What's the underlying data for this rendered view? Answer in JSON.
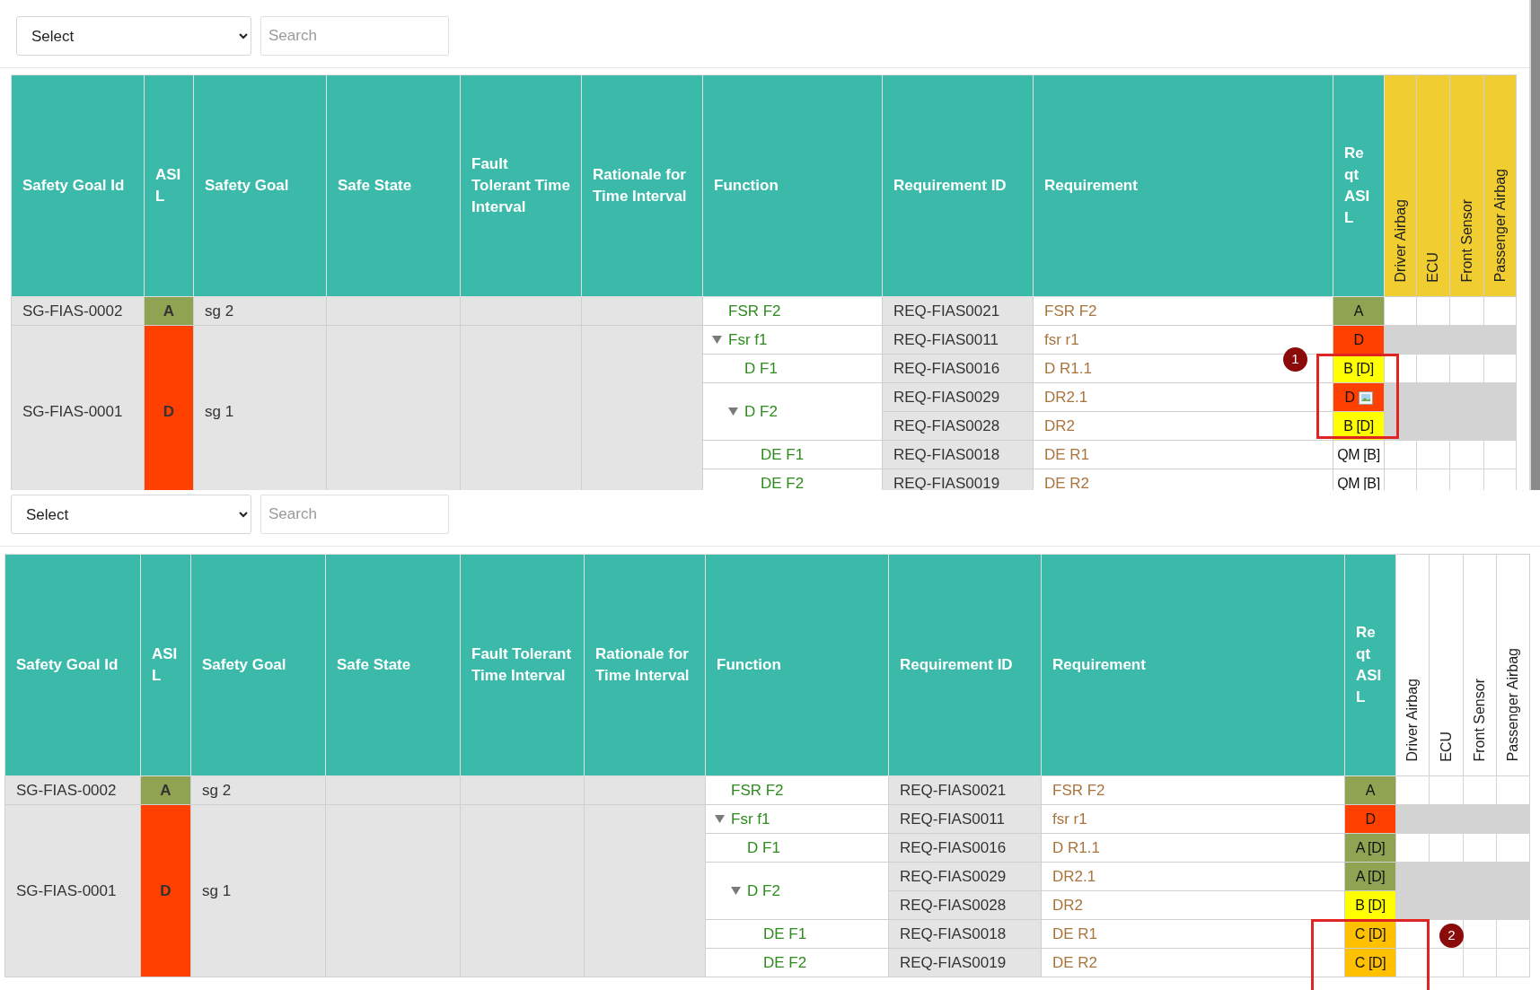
{
  "panels": [
    {
      "select": {
        "value": "Select"
      },
      "search": {
        "placeholder": "Search"
      },
      "columns": [
        "Safety Goal Id",
        "ASIL",
        "Safety Goal",
        "Safe State",
        "Fault Tolerant Time Interval",
        "Rationale for Time Interval",
        "Function",
        "Requirement ID",
        "Requirement",
        "Reqt ASIL"
      ],
      "allocation_columns": [
        {
          "label": "Driver Airbag",
          "highlighted": true
        },
        {
          "label": "ECU",
          "highlighted": true
        },
        {
          "label": "Front Sensor",
          "highlighted": true
        },
        {
          "label": "Passenger Airbag",
          "highlighted": true
        }
      ],
      "safety_goals": [
        {
          "id": "SG-FIAS-0002",
          "asil": "A",
          "color": "#8fa352",
          "goal": "sg 2",
          "functions": [
            {
              "label": "FSR F2",
              "requirements": [
                {
                  "id": "REQ-FIAS0021",
                  "text": "FSR F2",
                  "asil": "A",
                  "color": "#8fa352",
                  "allocation_disabled": false
                }
              ]
            }
          ]
        },
        {
          "id": "SG-FIAS-0001",
          "asil": "D",
          "color": "#ff4000",
          "goal": "sg 1",
          "functions": [
            {
              "label": "Fsr f1",
              "expanded": true,
              "requirements": [
                {
                  "id": "REQ-FIAS0011",
                  "text": "fsr r1",
                  "asil": "D",
                  "color": "#ff4000",
                  "allocation_disabled": true
                }
              ],
              "children": [
                {
                  "label": "D F1",
                  "requirements": [
                    {
                      "id": "REQ-FIAS0016",
                      "text": "D R1.1",
                      "asil": "B [D]",
                      "color": "#ffff00",
                      "allocation_disabled": false
                    }
                  ]
                },
                {
                  "label": "D F2",
                  "expanded": true,
                  "requirements": [
                    {
                      "id": "REQ-FIAS0029",
                      "text": "DR2.1",
                      "asil": "D",
                      "color": "#ff4000",
                      "allocation_disabled": true,
                      "image_icon": true
                    },
                    {
                      "id": "REQ-FIAS0028",
                      "text": "DR2",
                      "asil": "B [D]",
                      "color": "#ffff00",
                      "allocation_disabled": true
                    }
                  ],
                  "children": [
                    {
                      "label": "DE F1",
                      "requirements": [
                        {
                          "id": "REQ-FIAS0018",
                          "text": "DE R1",
                          "asil": "QM [B]",
                          "color": "#ffffff",
                          "allocation_disabled": false
                        }
                      ]
                    },
                    {
                      "label": "DE F2",
                      "requirements": [
                        {
                          "id": "REQ-FIAS0019",
                          "text": "DE R2",
                          "asil": "QM [B]",
                          "color": "#ffffff",
                          "allocation_disabled": false
                        }
                      ]
                    }
                  ]
                }
              ]
            }
          ]
        }
      ],
      "annotation": {
        "label": "1"
      }
    },
    {
      "select": {
        "value": "Select"
      },
      "search": {
        "placeholder": "Search"
      },
      "columns": [
        "Safety Goal Id",
        "ASIL",
        "Safety Goal",
        "Safe State",
        "Fault Tolerant Time Interval",
        "Rationale for Time Interval",
        "Function",
        "Requirement ID",
        "Requirement",
        "Reqt ASIL"
      ],
      "allocation_columns": [
        {
          "label": "Driver Airbag",
          "highlighted": false
        },
        {
          "label": "ECU",
          "highlighted": false
        },
        {
          "label": "Front Sensor",
          "highlighted": false
        },
        {
          "label": "Passenger Airbag",
          "highlighted": false
        }
      ],
      "safety_goals": [
        {
          "id": "SG-FIAS-0002",
          "asil": "A",
          "color": "#8fa352",
          "goal": "sg 2",
          "functions": [
            {
              "label": "FSR F2",
              "requirements": [
                {
                  "id": "REQ-FIAS0021",
                  "text": "FSR F2",
                  "asil": "A",
                  "color": "#8fa352",
                  "allocation_disabled": false
                }
              ]
            }
          ]
        },
        {
          "id": "SG-FIAS-0001",
          "asil": "D",
          "color": "#ff4000",
          "goal": "sg 1",
          "functions": [
            {
              "label": "Fsr f1",
              "expanded": true,
              "requirements": [
                {
                  "id": "REQ-FIAS0011",
                  "text": "fsr r1",
                  "asil": "D",
                  "color": "#ff4000",
                  "allocation_disabled": true
                }
              ],
              "children": [
                {
                  "label": "D F1",
                  "requirements": [
                    {
                      "id": "REQ-FIAS0016",
                      "text": "D R1.1",
                      "asil": "A [D]",
                      "color": "#8fa352",
                      "allocation_disabled": false
                    }
                  ]
                },
                {
                  "label": "D F2",
                  "expanded": true,
                  "requirements": [
                    {
                      "id": "REQ-FIAS0029",
                      "text": "DR2.1",
                      "asil": "A [D]",
                      "color": "#8fa352",
                      "allocation_disabled": true
                    },
                    {
                      "id": "REQ-FIAS0028",
                      "text": "DR2",
                      "asil": "B [D]",
                      "color": "#ffff00",
                      "allocation_disabled": true
                    }
                  ],
                  "children": [
                    {
                      "label": "DE F1",
                      "requirements": [
                        {
                          "id": "REQ-FIAS0018",
                          "text": "DE R1",
                          "asil": "C [D]",
                          "color": "#ffc000",
                          "allocation_disabled": false
                        }
                      ]
                    },
                    {
                      "label": "DE F2",
                      "requirements": [
                        {
                          "id": "REQ-FIAS0019",
                          "text": "DE R2",
                          "asil": "C [D]",
                          "color": "#ffc000",
                          "allocation_disabled": false
                        }
                      ]
                    }
                  ]
                }
              ]
            }
          ]
        }
      ],
      "annotation": {
        "label": "2"
      }
    }
  ]
}
